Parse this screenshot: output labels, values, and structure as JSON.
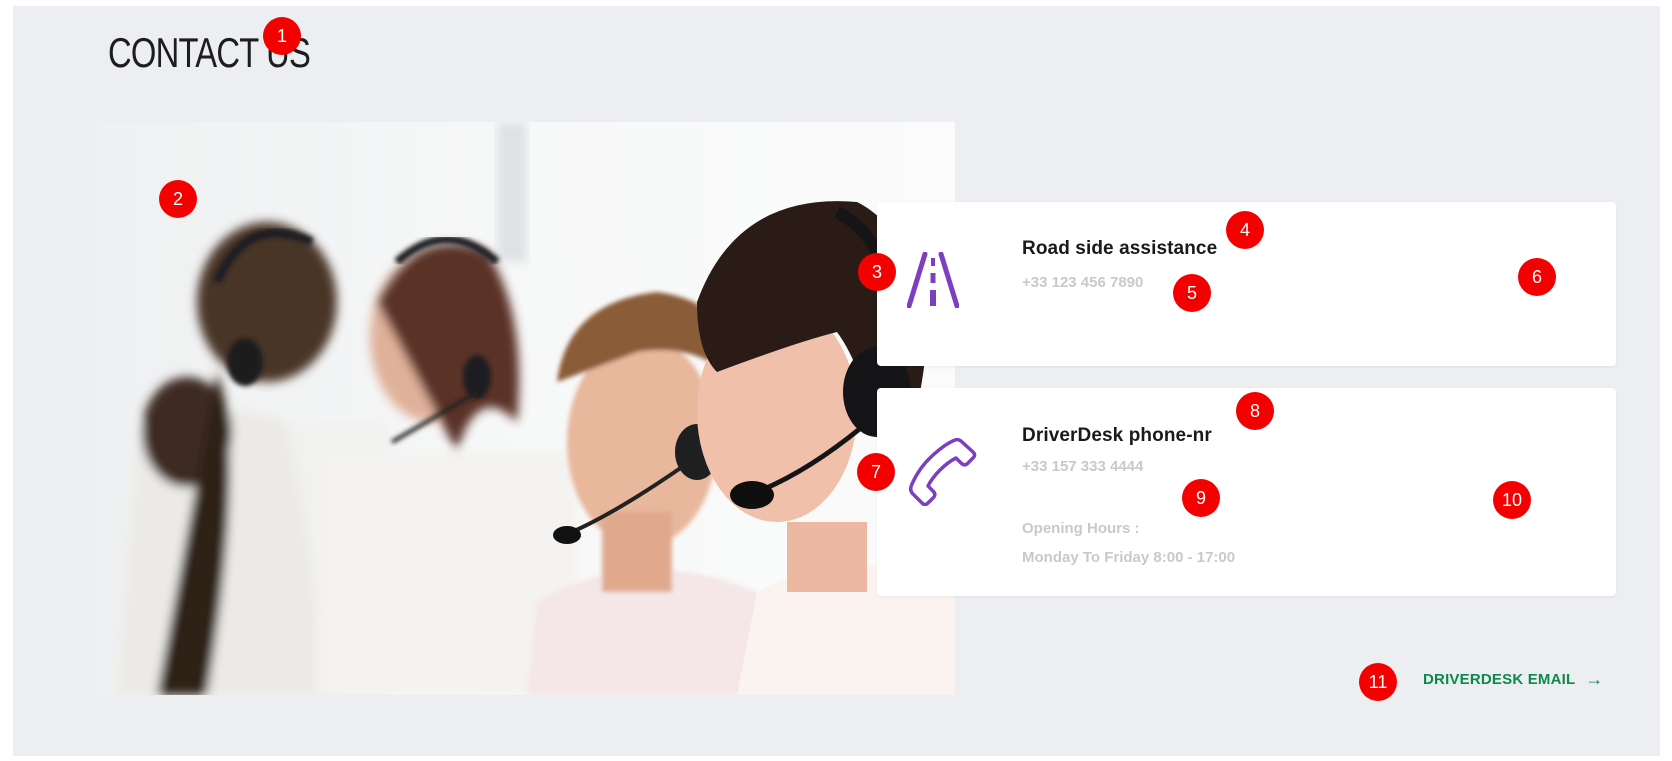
{
  "page": {
    "title": "CONTACT US"
  },
  "photo": {
    "subject": "call-center-agents-with-headsets"
  },
  "cards": [
    {
      "title": "Road side assistance",
      "phone": "+33 123 456 7890",
      "icon": "road-icon"
    },
    {
      "title": "DriverDesk phone-nr",
      "phone": "+33 157 333 4444",
      "hours_label": "Opening Hours :",
      "hours_value": "Monday To Friday 8:00 - 17:00",
      "icon": "phone-icon"
    }
  ],
  "email_link": {
    "label": "DRIVERDESK EMAIL",
    "icon": "arrow-right-icon",
    "arrow": "→"
  },
  "markers": [
    "1",
    "2",
    "3",
    "4",
    "5",
    "6",
    "7",
    "8",
    "9",
    "10",
    "11"
  ],
  "colors": {
    "accent_purple": "#7c3fbf",
    "link_green": "#0c8a4c",
    "marker_red": "#f40000",
    "panel_bg": "#eceef1"
  }
}
